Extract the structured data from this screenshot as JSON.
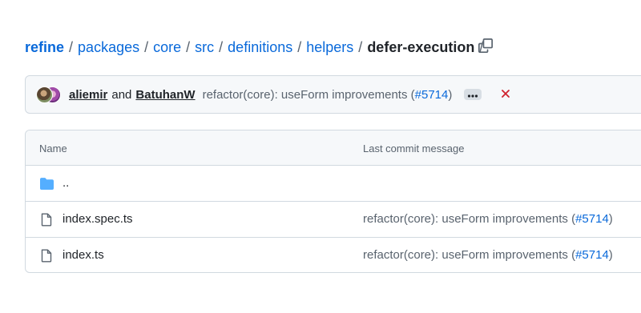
{
  "breadcrumb": {
    "repo": "refine",
    "parts": [
      "packages",
      "core",
      "src",
      "definitions",
      "helpers"
    ],
    "current": "defer-execution",
    "separator": "/",
    "copy_icon": "copy-icon"
  },
  "commit": {
    "author1": "aliemir",
    "and": "and",
    "author2": "BatuhanW",
    "message_prefix": "refactor(core): useForm improvements (",
    "pr": "#5714",
    "message_suffix": ")",
    "more_icon": "kebab-horizontal-icon",
    "status_icon": "x-icon",
    "status_color": "#cf222e"
  },
  "files": {
    "header_name": "Name",
    "header_message": "Last commit message",
    "rows": [
      {
        "name": "..",
        "icon": "folder-icon",
        "message_prefix": "",
        "pr": "",
        "message_suffix": ""
      },
      {
        "name": "index.spec.ts",
        "icon": "file-icon",
        "message_prefix": "refactor(core): useForm improvements (",
        "pr": "#5714",
        "message_suffix": ")"
      },
      {
        "name": "index.ts",
        "icon": "file-icon",
        "message_prefix": "refactor(core): useForm improvements (",
        "pr": "#5714",
        "message_suffix": ")"
      }
    ]
  },
  "colors": {
    "link": "#0969da",
    "muted": "#59636e",
    "folder": "#54aeff",
    "border": "#d1d9e0"
  }
}
